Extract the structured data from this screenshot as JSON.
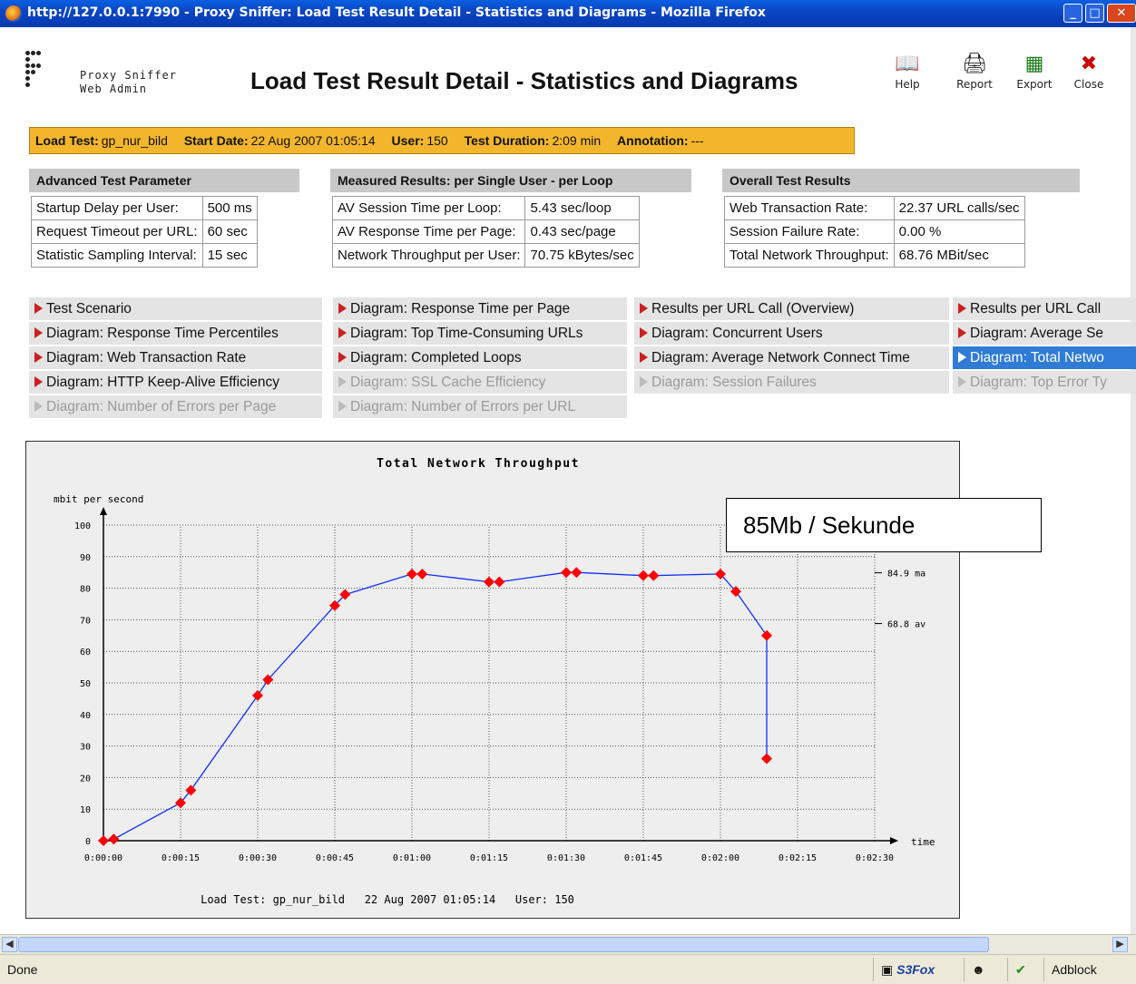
{
  "window": {
    "title": "http://127.0.0.1:7990 - Proxy Sniffer: Load Test Result Detail - Statistics and Diagrams - Mozilla Firefox"
  },
  "header": {
    "brand_line1": "Proxy Sniffer",
    "brand_line2": "Web Admin",
    "page_title": "Load Test Result Detail - Statistics and Diagrams",
    "tools": [
      {
        "label": "Help",
        "icon": "book-icon"
      },
      {
        "label": "Report",
        "icon": "printer-icon"
      },
      {
        "label": "Export",
        "icon": "spreadsheet-icon"
      },
      {
        "label": "Close",
        "icon": "x-icon"
      }
    ]
  },
  "infobar": {
    "load_test_label": "Load Test:",
    "load_test_value": "gp_nur_bild",
    "start_date_label": "Start Date:",
    "start_date_value": "22 Aug 2007 01:05:14",
    "user_label": "User:",
    "user_value": "150",
    "duration_label": "Test Duration:",
    "duration_value": "2:09 min",
    "annotation_label": "Annotation:",
    "annotation_value": "---"
  },
  "advanced": {
    "title": "Advanced Test Parameter",
    "rows": [
      {
        "label": "Startup Delay per User:",
        "value": "500 ms"
      },
      {
        "label": "Request Timeout per URL:",
        "value": "60 sec"
      },
      {
        "label": "Statistic Sampling Interval:",
        "value": "15 sec"
      }
    ]
  },
  "measured": {
    "title": "Measured Results: per Single User - per Loop",
    "rows": [
      {
        "label": "AV Session Time per Loop:",
        "value": "5.43 sec/loop"
      },
      {
        "label": "AV Response Time per Page:",
        "value": "0.43 sec/page"
      },
      {
        "label": "Network Throughput per User:",
        "value": "70.75 kBytes/sec"
      }
    ]
  },
  "overall": {
    "title": "Overall Test Results",
    "rows": [
      {
        "label": "Web Transaction Rate:",
        "value": "22.37 URL calls/sec"
      },
      {
        "label": "Session Failure Rate:",
        "value": "0.00 %"
      },
      {
        "label": "Total Network Throughput:",
        "value": "68.76 MBit/sec"
      }
    ]
  },
  "nav": [
    [
      "Test Scenario",
      "Diagram: Response Time per Page",
      "Results per URL Call (Overview)",
      "Results per URL Call"
    ],
    [
      "Diagram: Response Time Percentiles",
      "Diagram: Top Time-Consuming URLs",
      "Diagram: Concurrent Users",
      "Diagram: Average Se"
    ],
    [
      "Diagram: Web Transaction Rate",
      "Diagram: Completed Loops",
      "Diagram: Average Network Connect Time",
      "Diagram: Total Netwo"
    ],
    [
      "Diagram: HTTP Keep-Alive Efficiency",
      "Diagram: SSL Cache Efficiency",
      "Diagram: Session Failures",
      "Diagram: Top Error Ty"
    ],
    [
      "Diagram: Number of Errors per Page",
      "Diagram: Number of Errors per URL"
    ]
  ],
  "chart_data": {
    "type": "line",
    "title": "Total Network Throughput",
    "ylabel": "mbit per second",
    "xlabel": "time",
    "ylim": [
      0,
      100
    ],
    "y_ticks": [
      0,
      10,
      20,
      30,
      40,
      50,
      60,
      70,
      80,
      90,
      100
    ],
    "x_ticks": [
      "0:00:00",
      "0:00:15",
      "0:00:30",
      "0:00:45",
      "0:01:00",
      "0:01:15",
      "0:01:30",
      "0:01:45",
      "0:02:00",
      "0:02:15",
      "0:02:30"
    ],
    "x_range_seconds": [
      0,
      150
    ],
    "grid": true,
    "points": [
      {
        "x": 0,
        "y": 0
      },
      {
        "x": 2,
        "y": 0.5
      },
      {
        "x": 15,
        "y": 12
      },
      {
        "x": 17,
        "y": 16
      },
      {
        "x": 30,
        "y": 46
      },
      {
        "x": 32,
        "y": 51
      },
      {
        "x": 45,
        "y": 74.5
      },
      {
        "x": 47,
        "y": 78
      },
      {
        "x": 60,
        "y": 84.5
      },
      {
        "x": 62,
        "y": 84.5
      },
      {
        "x": 75,
        "y": 82
      },
      {
        "x": 77,
        "y": 82
      },
      {
        "x": 90,
        "y": 85
      },
      {
        "x": 92,
        "y": 85
      },
      {
        "x": 105,
        "y": 84
      },
      {
        "x": 107,
        "y": 84
      },
      {
        "x": 120,
        "y": 84.5
      },
      {
        "x": 123,
        "y": 79
      },
      {
        "x": 129,
        "y": 65
      },
      {
        "x": 129,
        "y": 26
      }
    ],
    "ref_lines": [
      {
        "y": 84.9,
        "label": "84.9 ma"
      },
      {
        "y": 68.8,
        "label": "68.8 av"
      }
    ],
    "footer": "Load Test: gp_nur_bild   22 Aug 2007 01:05:14   User: 150",
    "series_color": "#1030ff",
    "marker_color": "#ff0000"
  },
  "callout": {
    "text": "85Mb / Sekunde"
  },
  "status": {
    "text": "Done",
    "s3fox": "S3Fox",
    "adblock": "Adblock"
  }
}
